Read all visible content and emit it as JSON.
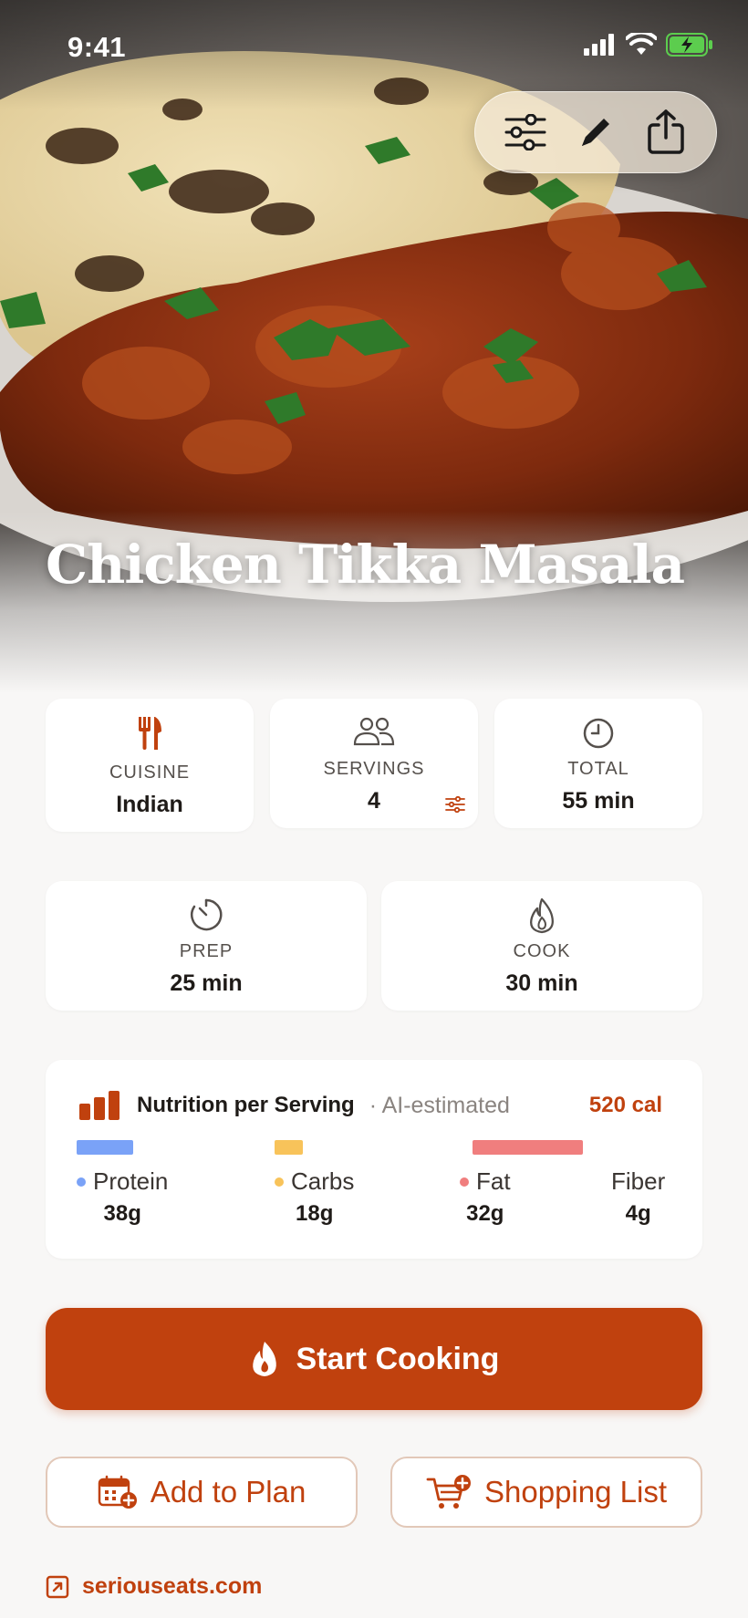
{
  "status_bar": {
    "time": "9:41"
  },
  "header_actions": [
    "sliders-icon",
    "pencil-icon",
    "share-icon"
  ],
  "recipe": {
    "title": "Chicken Tikka Masala"
  },
  "meta": {
    "cuisine": {
      "label": "CUISINE",
      "value": "Indian"
    },
    "servings": {
      "label": "SERVINGS",
      "value": "4"
    },
    "total": {
      "label": "TOTAL",
      "value": "55 min"
    },
    "prep": {
      "label": "PREP",
      "value": "25 min"
    },
    "cook": {
      "label": "COOK",
      "value": "30 min"
    }
  },
  "nutrition": {
    "title": "Nutrition per Serving",
    "note": "· AI-estimated",
    "calories": "520 cal",
    "macros": [
      {
        "name": "Protein",
        "value": "38g",
        "color": "#7aa2f7"
      },
      {
        "name": "Carbs",
        "value": "18g",
        "color": "#f8c35a"
      },
      {
        "name": "Fat",
        "value": "32g",
        "color": "#f07e7e"
      },
      {
        "name": "Fiber",
        "value": "4g",
        "color": ""
      }
    ]
  },
  "actions": {
    "start_cooking": "Start Cooking",
    "add_to_plan": "Add to Plan",
    "shopping_list": "Shopping List"
  },
  "source": {
    "domain": "seriouseats.com"
  },
  "colors": {
    "accent": "#c0410e",
    "background": "#f8f7f6"
  }
}
